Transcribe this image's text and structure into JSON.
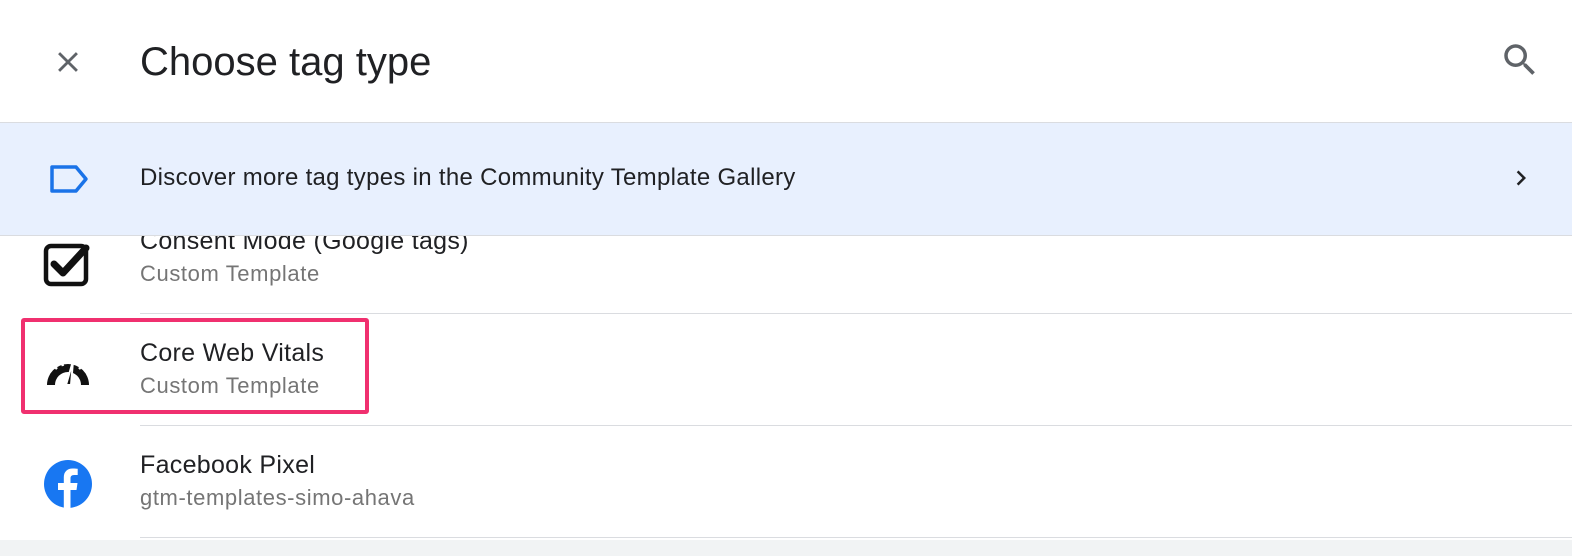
{
  "header": {
    "title": "Choose tag type",
    "close_icon": "close-icon",
    "search_icon": "search-icon"
  },
  "gallery_banner": {
    "text": "Discover more tag types in the Community Template Gallery",
    "icon": "tag-label-icon",
    "chevron_icon": "chevron-right-icon",
    "background": "#e8f0fe",
    "icon_color": "#1a73e8"
  },
  "tag_types": [
    {
      "name": "Consent Mode (Google tags)",
      "subtitle": "Custom Template",
      "icon": "checkbox-checked-icon"
    },
    {
      "name": "Core Web Vitals",
      "subtitle": "Custom Template",
      "icon": "speedometer-icon",
      "highlighted": true
    },
    {
      "name": "Facebook Pixel",
      "subtitle": "gtm-templates-simo-ahava",
      "icon": "facebook-icon"
    }
  ],
  "colors": {
    "highlight": "#f0306f",
    "facebook_blue": "#1877f2",
    "subtitle_gray": "#757575"
  }
}
